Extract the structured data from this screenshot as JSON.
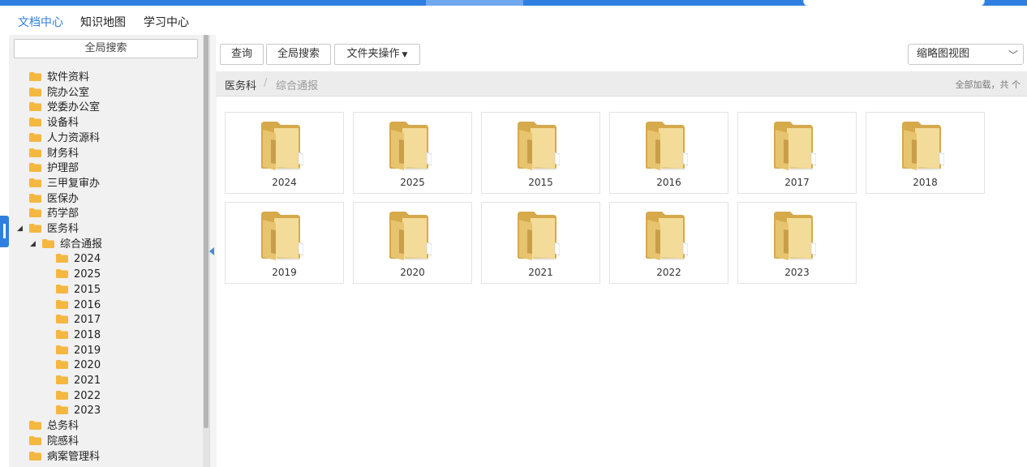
{
  "modules": {
    "tabs": [
      "文档中心",
      "知识地图",
      "学习中心"
    ],
    "active": 0
  },
  "sidebar": {
    "search_label": "全局搜索",
    "depts_top": [
      "软件资料",
      "院办公室",
      "党委办公室",
      "设备科",
      "人力资源科",
      "财务科",
      "护理部",
      "三甲复审办",
      "医保办",
      "药学部"
    ],
    "expanded_dept": "医务科",
    "expanded_sub": "综合通报",
    "years": [
      "2024",
      "2025",
      "2015",
      "2016",
      "2017",
      "2018",
      "2019",
      "2020",
      "2021",
      "2022",
      "2023"
    ],
    "depts_bottom": [
      "总务科",
      "院感科",
      "病案管理科"
    ]
  },
  "toolbar": {
    "query": "查询",
    "global_search": "全局搜索",
    "folder_ops": "文件夹操作",
    "view_select": "缩略图视图"
  },
  "breadcrumb": {
    "items": [
      "医务科",
      "综合通报"
    ],
    "separator": "/",
    "status": "全部加载，共 个"
  },
  "folders": [
    "2024",
    "2025",
    "2015",
    "2016",
    "2017",
    "2018",
    "2019",
    "2020",
    "2021",
    "2022",
    "2023"
  ],
  "colors": {
    "accent": "#2f7fe0",
    "folder_icon": "#f4b740",
    "folder_tile": "#e7c46f"
  }
}
